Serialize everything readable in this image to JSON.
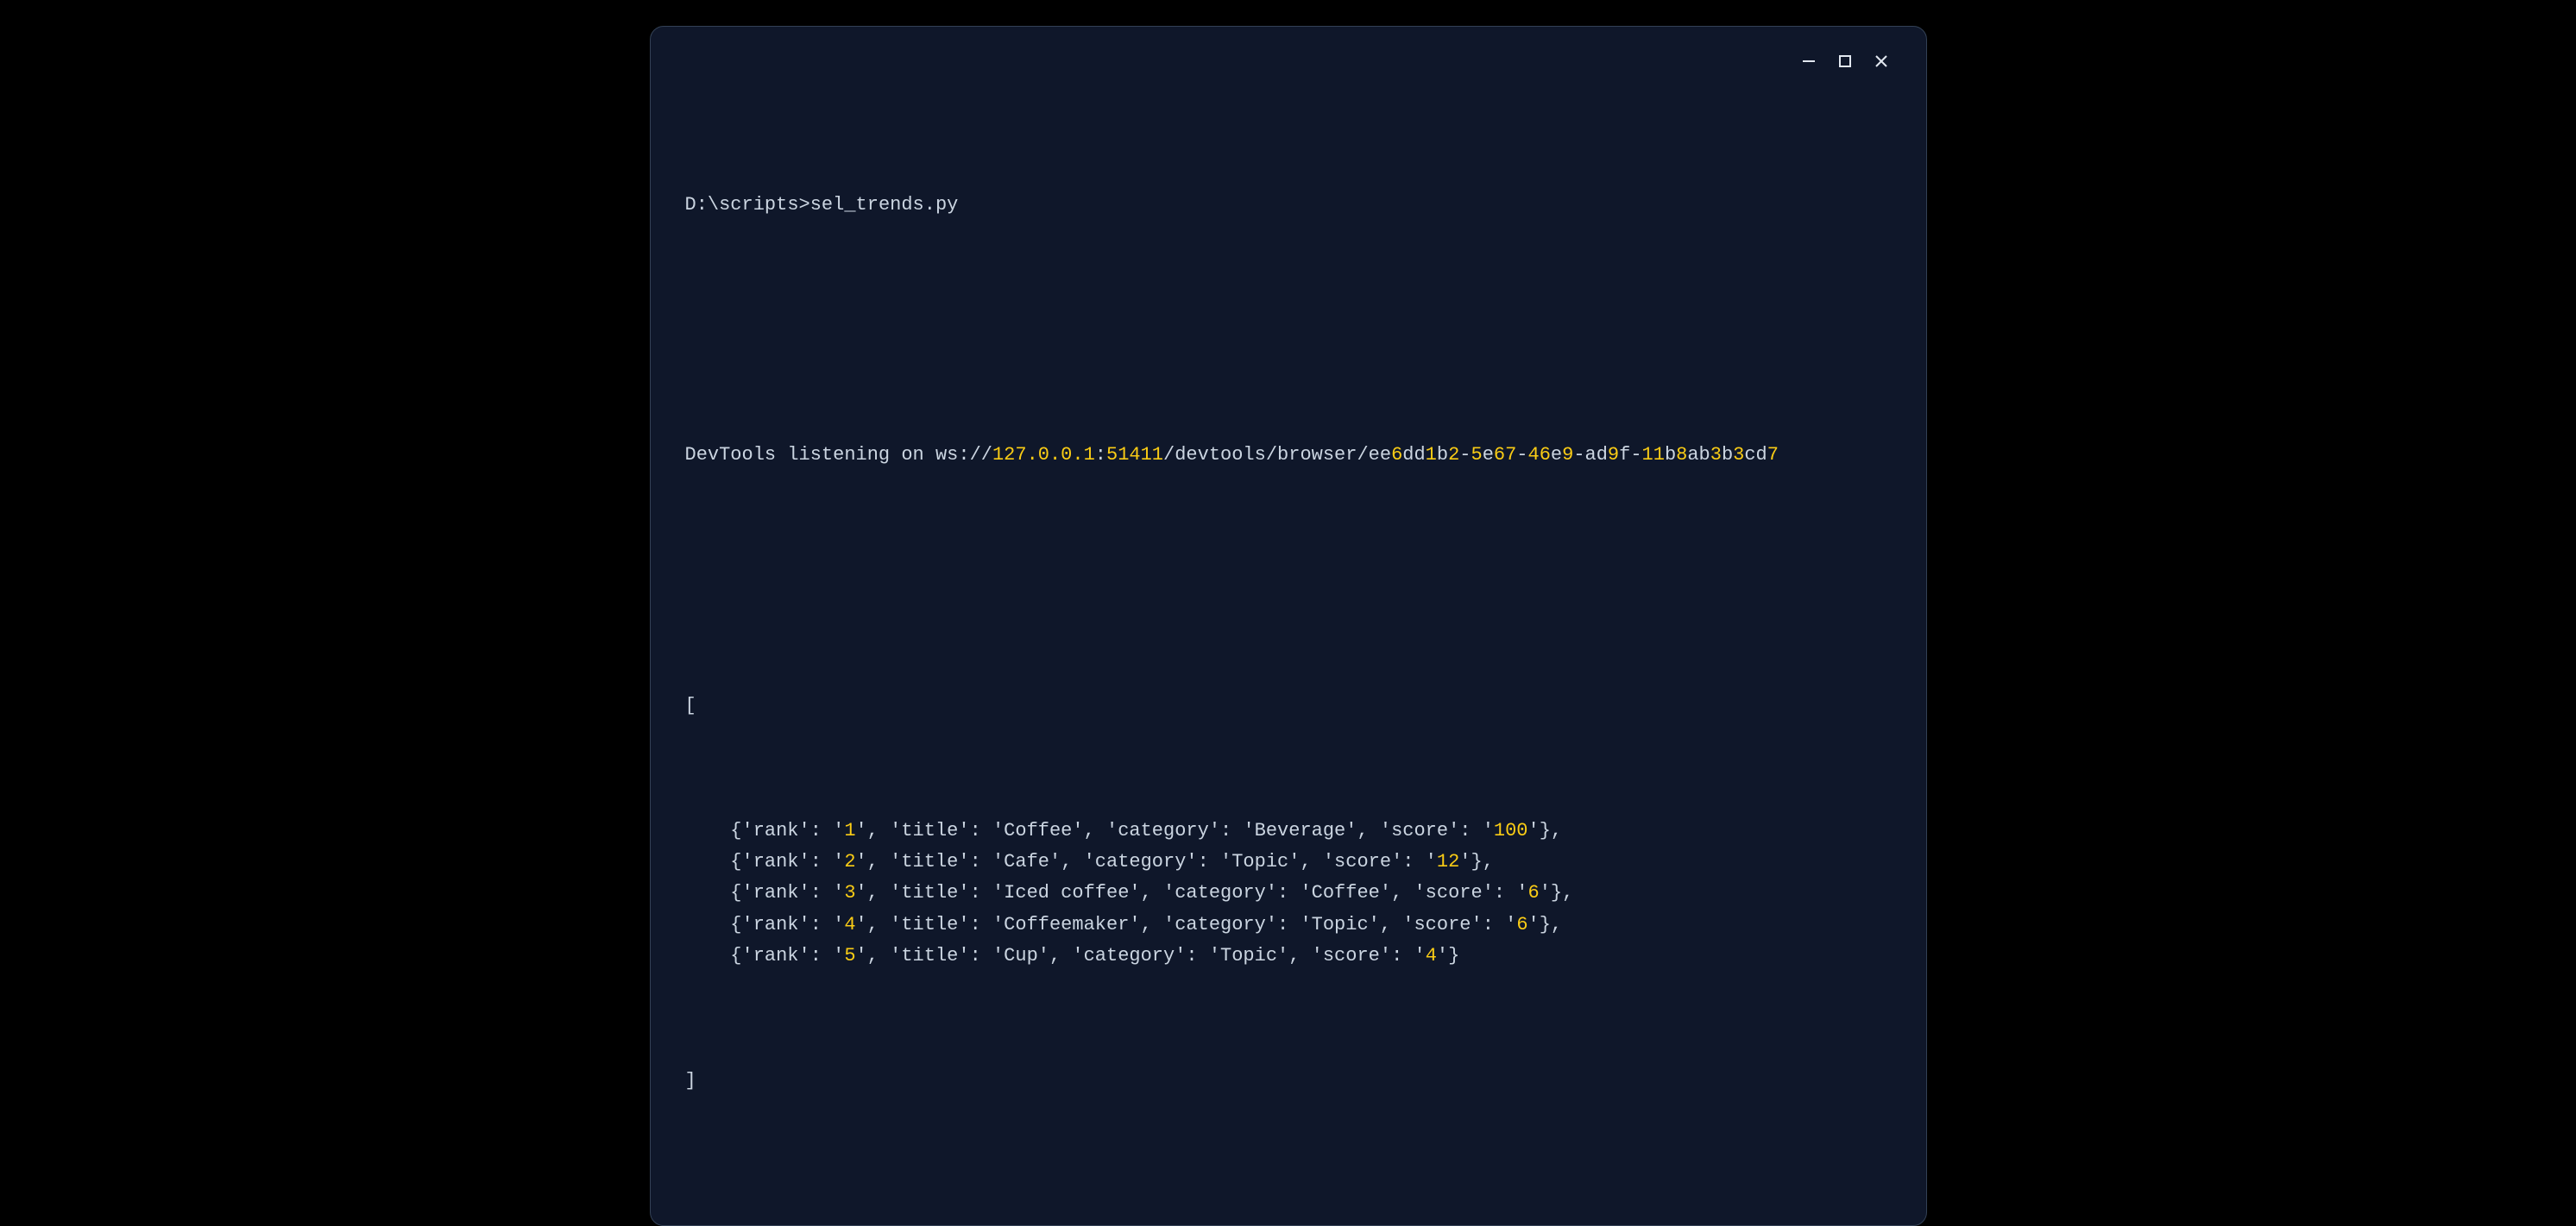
{
  "terminal": {
    "prompt_path": "D:\\scripts>",
    "command": "sel_trends.py",
    "devtools_prefix": "DevTools listening on ws:",
    "devtools_slashes": "//",
    "devtools_host": "127.0.0.1",
    "devtools_colon": ":",
    "devtools_port": "51411",
    "devtools_path": "/devtools/browser/ee",
    "guid_parts": [
      {
        "hl": true,
        "text": "6"
      },
      {
        "hl": false,
        "text": "dd"
      },
      {
        "hl": true,
        "text": "1"
      },
      {
        "hl": false,
        "text": "b"
      },
      {
        "hl": true,
        "text": "2"
      },
      {
        "hl": false,
        "text": "-"
      },
      {
        "hl": true,
        "text": "5"
      },
      {
        "hl": false,
        "text": "e"
      },
      {
        "hl": true,
        "text": "67"
      },
      {
        "hl": false,
        "text": "-"
      },
      {
        "hl": true,
        "text": "46"
      },
      {
        "hl": false,
        "text": "e"
      },
      {
        "hl": true,
        "text": "9"
      },
      {
        "hl": false,
        "text": "-ad"
      },
      {
        "hl": true,
        "text": "9"
      },
      {
        "hl": false,
        "text": "f-"
      },
      {
        "hl": true,
        "text": "11"
      },
      {
        "hl": false,
        "text": "b"
      },
      {
        "hl": true,
        "text": "8"
      },
      {
        "hl": false,
        "text": "ab"
      },
      {
        "hl": true,
        "text": "3"
      },
      {
        "hl": false,
        "text": "b"
      },
      {
        "hl": true,
        "text": "3"
      },
      {
        "hl": false,
        "text": "cd"
      },
      {
        "hl": true,
        "text": "7"
      }
    ],
    "open_br": "[",
    "close_br": "]",
    "rows": [
      {
        "rank": "1",
        "title": "Coffee",
        "category": "Beverage",
        "score": "100",
        "trailing_comma": true
      },
      {
        "rank": "2",
        "title": "Cafe",
        "category": "Topic",
        "score": "12",
        "trailing_comma": true
      },
      {
        "rank": "3",
        "title": "Iced coffee",
        "category": "Coffee",
        "score": "6",
        "trailing_comma": true
      },
      {
        "rank": "4",
        "title": "Coffeemaker",
        "category": "Topic",
        "score": "6",
        "trailing_comma": true
      },
      {
        "rank": "5",
        "title": "Cup",
        "category": "Topic",
        "score": "4",
        "trailing_comma": false
      }
    ],
    "keys": {
      "rank": "'rank'",
      "title": "'title'",
      "category": "'category'",
      "score": "'score'"
    }
  }
}
